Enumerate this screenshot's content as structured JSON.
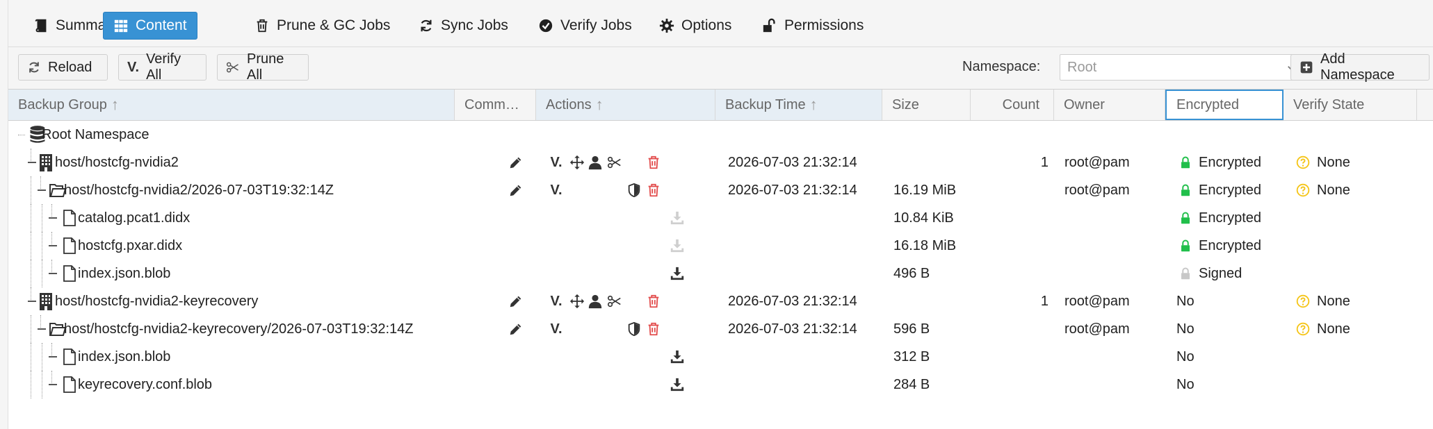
{
  "tabs": [
    {
      "label": "Summary",
      "icon": "book-icon",
      "active": false
    },
    {
      "label": "Content",
      "icon": "grid-icon",
      "active": true
    },
    {
      "label": "Prune & GC Jobs",
      "icon": "trash-icon",
      "active": false
    },
    {
      "label": "Sync Jobs",
      "icon": "sync-icon",
      "active": false
    },
    {
      "label": "Verify Jobs",
      "icon": "check-circle-icon",
      "active": false
    },
    {
      "label": "Options",
      "icon": "gear-icon",
      "active": false
    },
    {
      "label": "Permissions",
      "icon": "unlock-icon",
      "active": false
    }
  ],
  "toolbar": {
    "reload_label": "Reload",
    "verify_all_label": "Verify All",
    "prune_all_label": "Prune All",
    "namespace_label": "Namespace:",
    "namespace_placeholder": "Root",
    "add_namespace_label": "Add Namespace"
  },
  "columns": [
    {
      "label": "Backup Group",
      "sort": "↑"
    },
    {
      "label": "Comm…",
      "sort": ""
    },
    {
      "label": "Actions",
      "sort": "↑"
    },
    {
      "label": "Backup Time",
      "sort": "↑"
    },
    {
      "label": "Size",
      "sort": ""
    },
    {
      "label": "Count",
      "sort": ""
    },
    {
      "label": "Owner",
      "sort": ""
    },
    {
      "label": "Encrypted",
      "sort": ""
    },
    {
      "label": "Verify State",
      "sort": ""
    }
  ],
  "rows": [
    {
      "name": "Root Namespace",
      "type": "namespace",
      "level": 0,
      "time": "",
      "size": "",
      "count": "",
      "owner": "",
      "encrypted": "",
      "verify": ""
    },
    {
      "name": "host/hostcfg-nvidia2",
      "type": "group",
      "level": 1,
      "time": "2026-07-03 21:32:14",
      "size": "",
      "count": "1",
      "owner": "root@pam",
      "encrypted": "Encrypted",
      "verify": "None"
    },
    {
      "name": "host/hostcfg-nvidia2/2026-07-03T19:32:14Z",
      "type": "snapshot",
      "level": 2,
      "time": "2026-07-03 21:32:14",
      "size": "16.19 MiB",
      "count": "",
      "owner": "root@pam",
      "encrypted": "Encrypted",
      "verify": "None"
    },
    {
      "name": "catalog.pcat1.didx",
      "type": "file",
      "level": 3,
      "time": "",
      "size": "10.84 KiB",
      "count": "",
      "owner": "",
      "encrypted": "Encrypted",
      "verify": ""
    },
    {
      "name": "hostcfg.pxar.didx",
      "type": "file",
      "level": 3,
      "time": "",
      "size": "16.18 MiB",
      "count": "",
      "owner": "",
      "encrypted": "Encrypted",
      "verify": ""
    },
    {
      "name": "index.json.blob",
      "type": "file",
      "level": 3,
      "time": "",
      "size": "496 B",
      "count": "",
      "owner": "",
      "encrypted": "Signed",
      "verify": ""
    },
    {
      "name": "host/hostcfg-nvidia2-keyrecovery",
      "type": "group",
      "level": 1,
      "time": "2026-07-03 21:32:14",
      "size": "",
      "count": "1",
      "owner": "root@pam",
      "encrypted": "No",
      "verify": "None"
    },
    {
      "name": "host/hostcfg-nvidia2-keyrecovery/2026-07-03T19:32:14Z",
      "type": "snapshot",
      "level": 2,
      "time": "2026-07-03 21:32:14",
      "size": "596 B",
      "count": "",
      "owner": "root@pam",
      "encrypted": "No",
      "verify": "None"
    },
    {
      "name": "index.json.blob",
      "type": "file",
      "level": 3,
      "time": "",
      "size": "312 B",
      "count": "",
      "owner": "",
      "encrypted": "No",
      "verify": ""
    },
    {
      "name": "keyrecovery.conf.blob",
      "type": "file",
      "level": 3,
      "time": "",
      "size": "284 B",
      "count": "",
      "owner": "",
      "encrypted": "No",
      "verify": ""
    }
  ],
  "colors": {
    "accent": "#3892d4",
    "delete_red": "#e24b4b",
    "lock_green": "#21bf4b",
    "verify_yellow": "#f5c518"
  }
}
